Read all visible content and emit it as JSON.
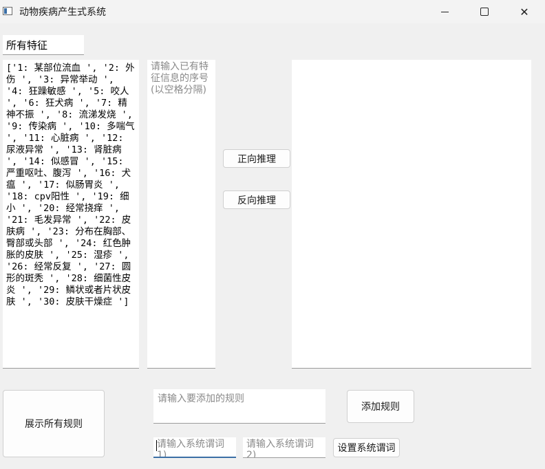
{
  "window": {
    "title": "动物疾病产生式系统",
    "min_glyph": "",
    "max_glyph": "",
    "close_glyph": "✕"
  },
  "features_label": "所有特征",
  "features_text": "['1: 某部位流血 ', '2: 外伤 ', '3: 异常举动 ', '4: 狂躁敏感 ', '5: 咬人 ', '6: 狂犬病 ', '7: 精神不振 ', '8: 流涕发烧 ', '9: 传染病 ', '10: 多喘气 ', '11: 心脏病 ', '12: 尿液异常 ', '13: 肾脏病 ', '14: 似感冒 ', '15: 严重呕吐、腹泻 ', '16: 犬瘟 ', '17: 似肠胃炎 ', '18: cpv阳性 ', '19: 细小 ', '20: 经常挠痒 ', '21: 毛发异常 ', '22: 皮肤病 ', '23: 分布在胸部、臀部或头部 ', '24: 红色肿胀的皮肤 ', '25: 湿疹 ', '26: 经常反复 ', '27: 圆形的斑秃 ', '28: 细菌性皮炎 ', '29: 鳞状或者片状皮肤 ', '30: 皮肤干燥症 ']",
  "sequence_placeholder": "请输入已有特征信息的序号(以空格分隔)",
  "buttons": {
    "forward": "正向推理",
    "backward": "反向推理",
    "show_rules": "展示所有规则",
    "add_rule": "添加规则",
    "set_terms": "设置系统谓词"
  },
  "inputs": {
    "rule_placeholder": "请输入要添加的规则",
    "term1_placeholder": "请输入系统谓词1)",
    "term2_placeholder": "请输入系统谓词2)"
  }
}
